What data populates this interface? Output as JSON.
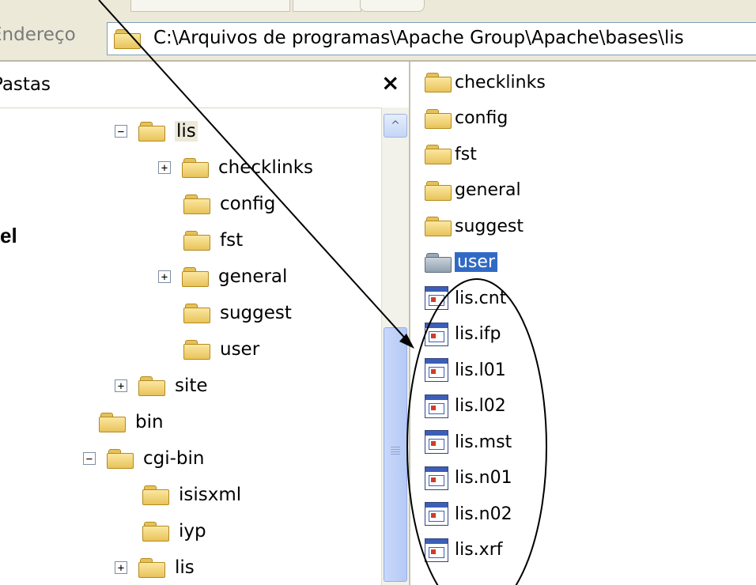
{
  "address": {
    "label": "Endereço",
    "path": "C:\\Arquivos de programas\\Apache Group\\Apache\\bases\\lis"
  },
  "folders_pane": {
    "title": "Pastas",
    "close_label": "×",
    "scroll_up_label": "^",
    "tree": [
      {
        "label": "lis",
        "expander": "−",
        "selected": true
      },
      {
        "label": "checklinks",
        "expander": "+"
      },
      {
        "label": "config"
      },
      {
        "label": "fst"
      },
      {
        "label": "general",
        "expander": "+"
      },
      {
        "label": "suggest"
      },
      {
        "label": "user"
      },
      {
        "label": "site",
        "expander": "+"
      },
      {
        "label": "bin"
      },
      {
        "label": "cgi-bin",
        "expander": "−"
      },
      {
        "label": "isisxml"
      },
      {
        "label": "iyp"
      },
      {
        "label": "lis",
        "expander": "+"
      }
    ]
  },
  "side_text": "el",
  "files": {
    "folders": [
      "checklinks",
      "config",
      "fst",
      "general",
      "suggest",
      "user"
    ],
    "selected_folder": "user",
    "files": [
      "lis.cnt",
      "lis.ifp",
      "lis.l01",
      "lis.l02",
      "lis.mst",
      "lis.n01",
      "lis.n02",
      "lis.xrf"
    ]
  },
  "colors": {
    "selection": "#316ac5",
    "toolbar": "#ece9d8",
    "folder_yellow": "#e9c35a"
  }
}
